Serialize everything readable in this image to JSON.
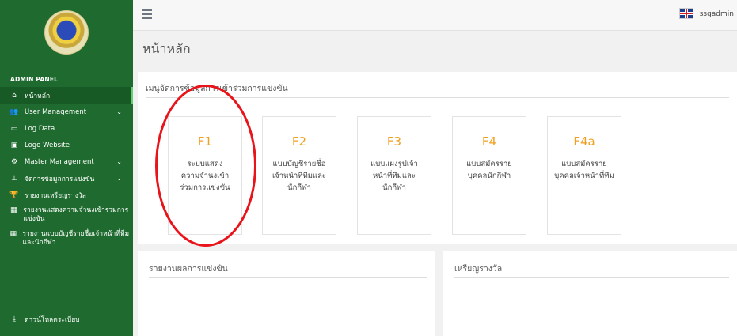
{
  "sidebar": {
    "admin_panel": "ADMIN PANEL",
    "items": [
      {
        "label": "หน้าหลัก",
        "icon": "home-icon"
      },
      {
        "label": "User Management",
        "icon": "users-icon"
      },
      {
        "label": "Log Data",
        "icon": "hdd-icon"
      },
      {
        "label": "Logo Website",
        "icon": "image-icon"
      },
      {
        "label": "Master Management",
        "icon": "cogs-icon"
      },
      {
        "label": "จัดการข้อมูลการแข่งขัน",
        "icon": "sitemap-icon"
      },
      {
        "label": "รายงานเหรียญรางวัล",
        "icon": "trophy-icon"
      },
      {
        "label": "รายงานแสดงความจำนงเข้าร่วมการแข่งขัน",
        "icon": "table-icon"
      },
      {
        "label": "รายงานแบบบัญชีรายชื่อเจ้าหน้าที่ทีมและนักกีฬา",
        "icon": "table-icon"
      },
      {
        "label": "ดาวน์โหลดระเบียบ",
        "icon": "download-icon"
      }
    ]
  },
  "topbar": {
    "username": "ssgadmin",
    "language_flag": "uk-flag-icon"
  },
  "page_title": "หน้าหลัก",
  "menu_panel": {
    "title": "เมนูจัดการข้อมูลการเข้าร่วมการแข่งขัน",
    "cards": [
      {
        "code": "F1",
        "desc": "ระบบแสดงความจำนงเข้าร่วมการแข่งขัน"
      },
      {
        "code": "F2",
        "desc": "แบบบัญชีรายชื่อเจ้าหน้าที่ทีมและนักกีฬา"
      },
      {
        "code": "F3",
        "desc": "แบบแผงรูปเจ้าหน้าที่ทีมและนักกีฬา"
      },
      {
        "code": "F4",
        "desc": "แบบสมัครรายบุคคลนักกีฬา"
      },
      {
        "code": "F4a",
        "desc": "แบบสมัครรายบุคคลเจ้าหน้าที่ทีม"
      }
    ]
  },
  "report_panel": {
    "title": "รายงานผลการแข่งขัน"
  },
  "medal_panel": {
    "title": "เหรียญรางวัล"
  },
  "colors": {
    "sidebar": "#1f6b2f",
    "card_code": "#f0a020",
    "annotation": "#e8141a"
  }
}
